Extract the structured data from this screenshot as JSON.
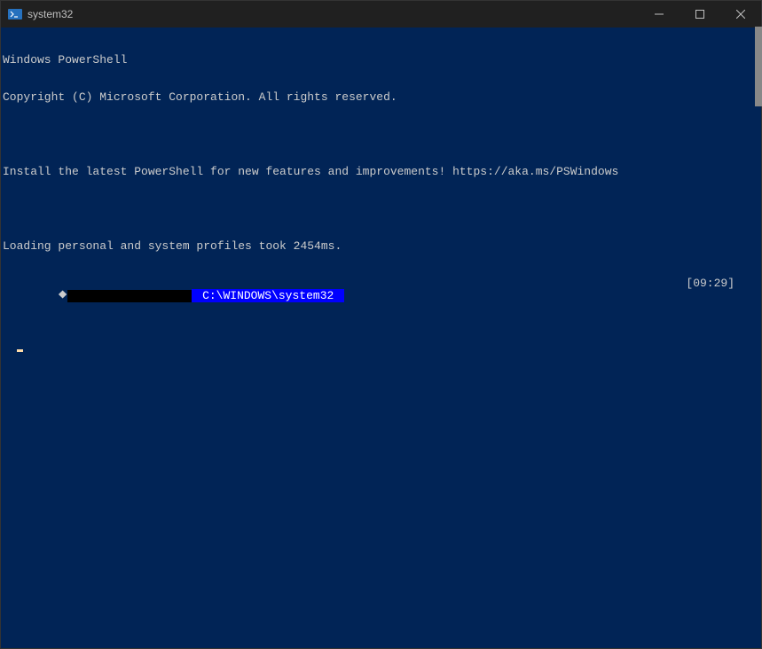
{
  "window": {
    "title": "system32"
  },
  "terminal": {
    "line1": "Windows PowerShell",
    "line2": "Copyright (C) Microsoft Corporation. All rights reserved.",
    "line3": "",
    "line4": "Install the latest PowerShell for new features and improvements! https://aka.ms/PSWindows",
    "line5": "",
    "line6": "Loading personal and system profiles took 2454ms.",
    "prompt": {
      "symbol": "⯁",
      "user_segment": "                  ",
      "path_segment": " C:\\WINDOWS\\system32 ",
      "time": "[09:29]"
    }
  }
}
